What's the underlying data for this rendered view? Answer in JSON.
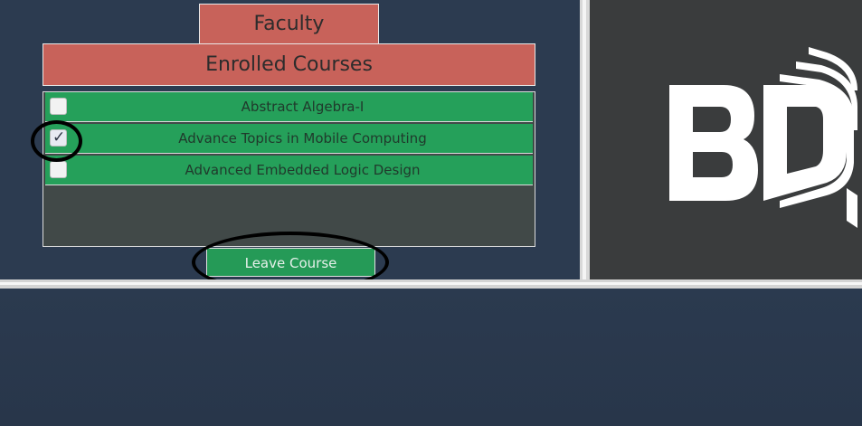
{
  "header": {
    "faculty_tab": "Faculty",
    "courses_title": "Enrolled Courses"
  },
  "courses": [
    {
      "label": "Abstract Algebra-I",
      "checked": false
    },
    {
      "label": "Advance Topics in Mobile Computing",
      "checked": true
    },
    {
      "label": "Advanced Embedded Logic Design",
      "checked": false
    }
  ],
  "actions": {
    "leave_course": "Leave Course"
  },
  "logo": {
    "text": "BD"
  },
  "colors": {
    "tab": "#c8625a",
    "row": "#25a05a",
    "background": "#2c3b50",
    "logo_panel": "#3a3c3d"
  }
}
